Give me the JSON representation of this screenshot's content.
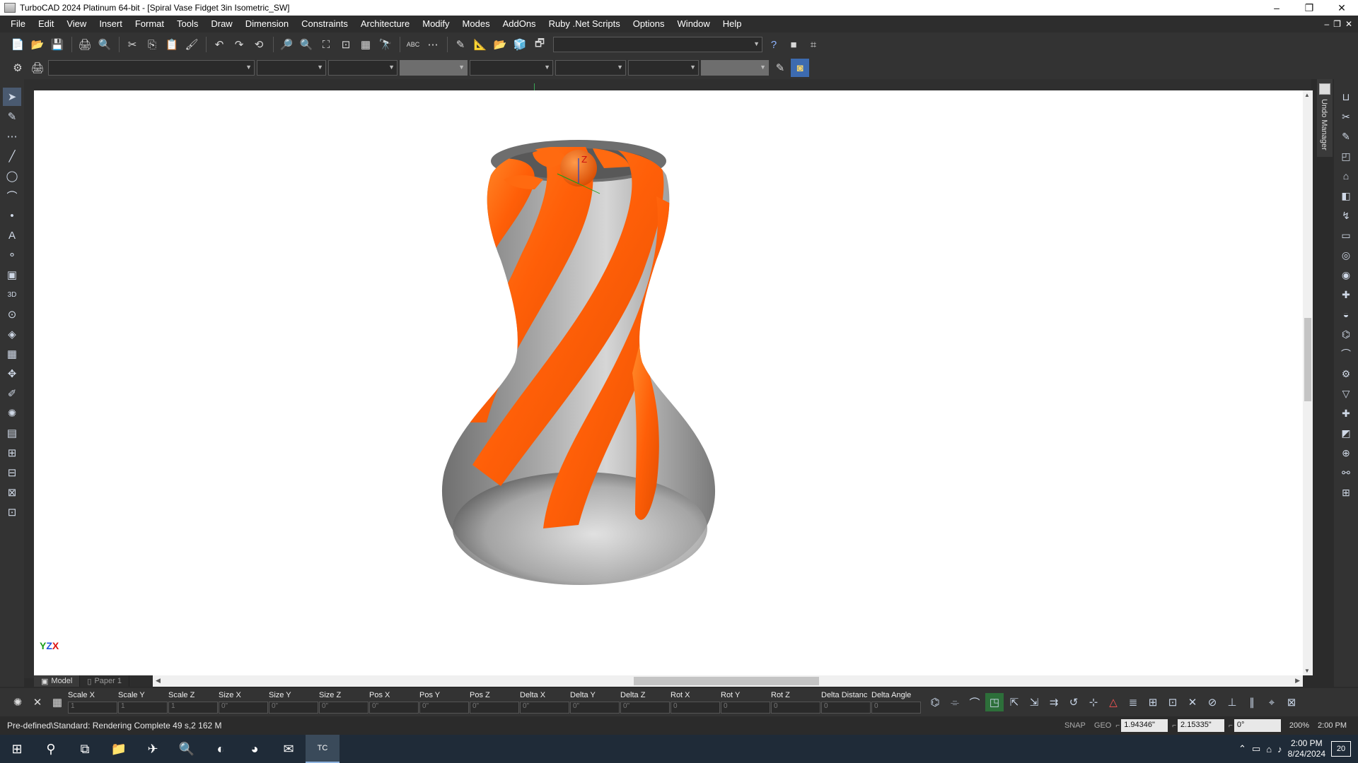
{
  "window": {
    "title": "TurboCAD 2024 Platinum 64-bit - [Spiral Vase Fidget 3in Isometric_SW]",
    "minimize": "–",
    "restore": "❐",
    "close": "✕"
  },
  "menu": [
    "File",
    "Edit",
    "View",
    "Insert",
    "Format",
    "Tools",
    "Draw",
    "Dimension",
    "Constraints",
    "Architecture",
    "Modify",
    "Modes",
    "AddOns",
    "Ruby .Net Scripts",
    "Options",
    "Window",
    "Help"
  ],
  "mdi_controls": {
    "minimize": "–",
    "restore": "❐",
    "close": "✕"
  },
  "toolbar1_icons": [
    "📄",
    "📂",
    "💾",
    "🖨",
    "🔍",
    "✂",
    "⎘",
    "📋",
    "🖌",
    "↶",
    "↷",
    "⟲",
    "🔎",
    "🔍",
    "⛶",
    "⊡",
    "▦",
    "🔭",
    "ABC",
    "⋯",
    "✎",
    "📐",
    "📂",
    "🧊",
    "🗗"
  ],
  "toolbar2_icons": [
    "⚙",
    "🖨"
  ],
  "left_tools": [
    "➤",
    "✎",
    "⋯",
    "╱",
    "◯",
    "⌒",
    "•",
    "A",
    "⚬",
    "▣",
    "3D",
    "⊙",
    "◈",
    "▦",
    "✥",
    "✐",
    "✺",
    "▤",
    "⊞",
    "⊟",
    "⊠",
    "⊡"
  ],
  "right_tools": [
    "⊔",
    "✂",
    "✎",
    "◰",
    "⌂",
    "◧",
    "↯",
    "▭",
    "◎",
    "◉",
    "✚",
    "◒",
    "⌬",
    "⌒",
    "⚙",
    "▽",
    "✚",
    "◩",
    "⊕",
    "⚯",
    "⊞"
  ],
  "undo_manager": {
    "label": "Undo Manager"
  },
  "viewport": {
    "axis_label": "Z",
    "indicator": {
      "y": "Y",
      "z": "Z",
      "x": "X"
    },
    "colors": {
      "orange": "#ff6a10",
      "gray": "#8c8c8c",
      "background": "#ffffff"
    }
  },
  "tabs": [
    {
      "label": "Model"
    },
    {
      "label": "Paper 1"
    }
  ],
  "inspector": {
    "fields": [
      "Scale X",
      "Scale Y",
      "Scale Z",
      "Size X",
      "Size Y",
      "Size Z",
      "Pos X",
      "Pos Y",
      "Pos Z",
      "Delta X",
      "Delta Y",
      "Delta Z",
      "Rot X",
      "Rot Y",
      "Rot Z",
      "Delta Distanc",
      "Delta Angle"
    ],
    "field_values": [
      "1",
      "1",
      "1",
      "0\"",
      "0\"",
      "0\"",
      "0\"",
      "0\"",
      "0\"",
      "0\"",
      "0\"",
      "0\"",
      "0",
      "0",
      "0",
      "0",
      "0"
    ]
  },
  "status": {
    "message": "Pre-defined\\Standard: Rendering Complete 49 s,2 162 M",
    "snap": "SNAP",
    "geo": "GEO",
    "coord_x": "1.94346\"",
    "coord_y": "2.15335\"",
    "angle": "0°",
    "zoom": "200%",
    "time": "2:00 PM"
  },
  "taskbar": {
    "time": "2:00 PM",
    "date": "8/24/2024",
    "notifications": "20",
    "apps": [
      "⊞",
      "⚲",
      "⧉",
      "📁",
      "✈",
      "🔍",
      "◐",
      "◕",
      "✉",
      "TC"
    ]
  }
}
